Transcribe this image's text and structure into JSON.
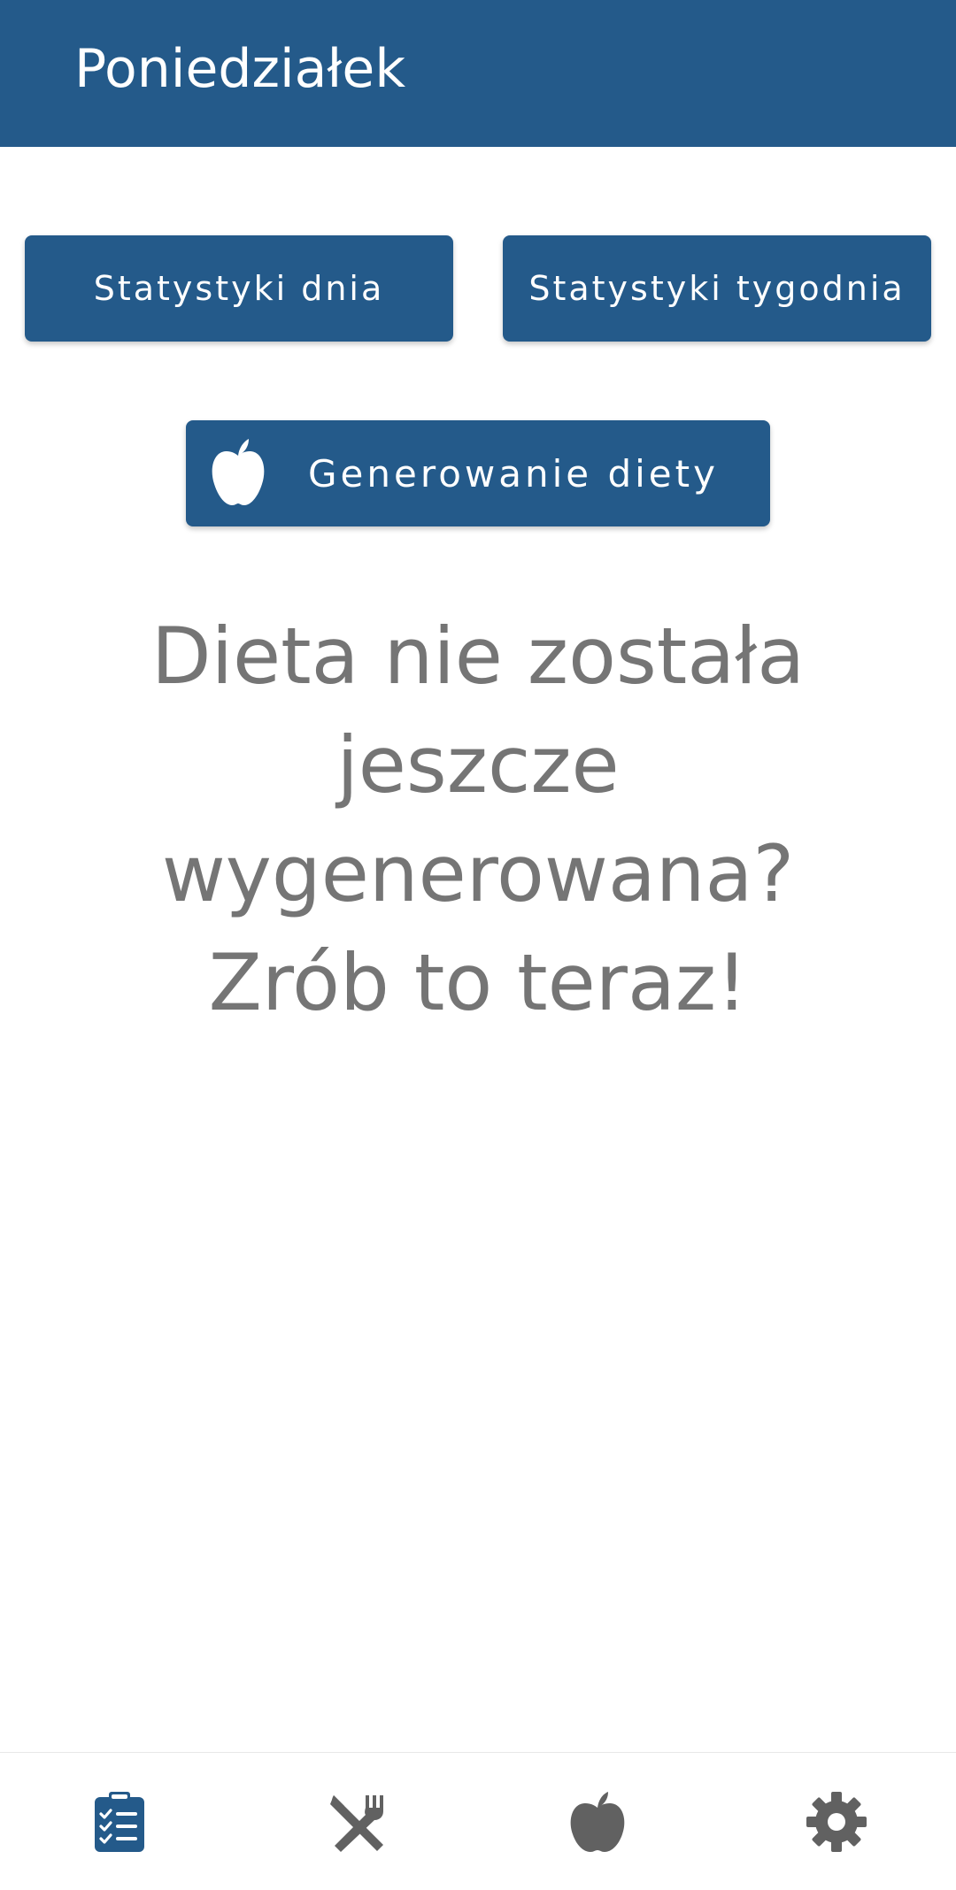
{
  "app_bar": {
    "title": "Poniedziałek"
  },
  "actions": {
    "day_stats_label": "Statystyki dnia",
    "week_stats_label": "Statystyki tygodnia",
    "generate_diet_label": "Generowanie diety",
    "generate_diet_icon": "apple-icon"
  },
  "empty_state": {
    "message": "Dieta nie została jeszcze wygenerowana? Zrób to teraz!"
  },
  "bottom_nav": {
    "items": [
      {
        "icon": "clipboard-checklist-icon",
        "active": true
      },
      {
        "icon": "fork-knife-icon",
        "active": false
      },
      {
        "icon": "apple-icon",
        "active": false
      },
      {
        "icon": "gear-icon",
        "active": false
      }
    ]
  },
  "colors": {
    "primary": "#245a8a",
    "text_muted": "#757575",
    "nav_inactive": "#616161",
    "background": "#ffffff"
  }
}
